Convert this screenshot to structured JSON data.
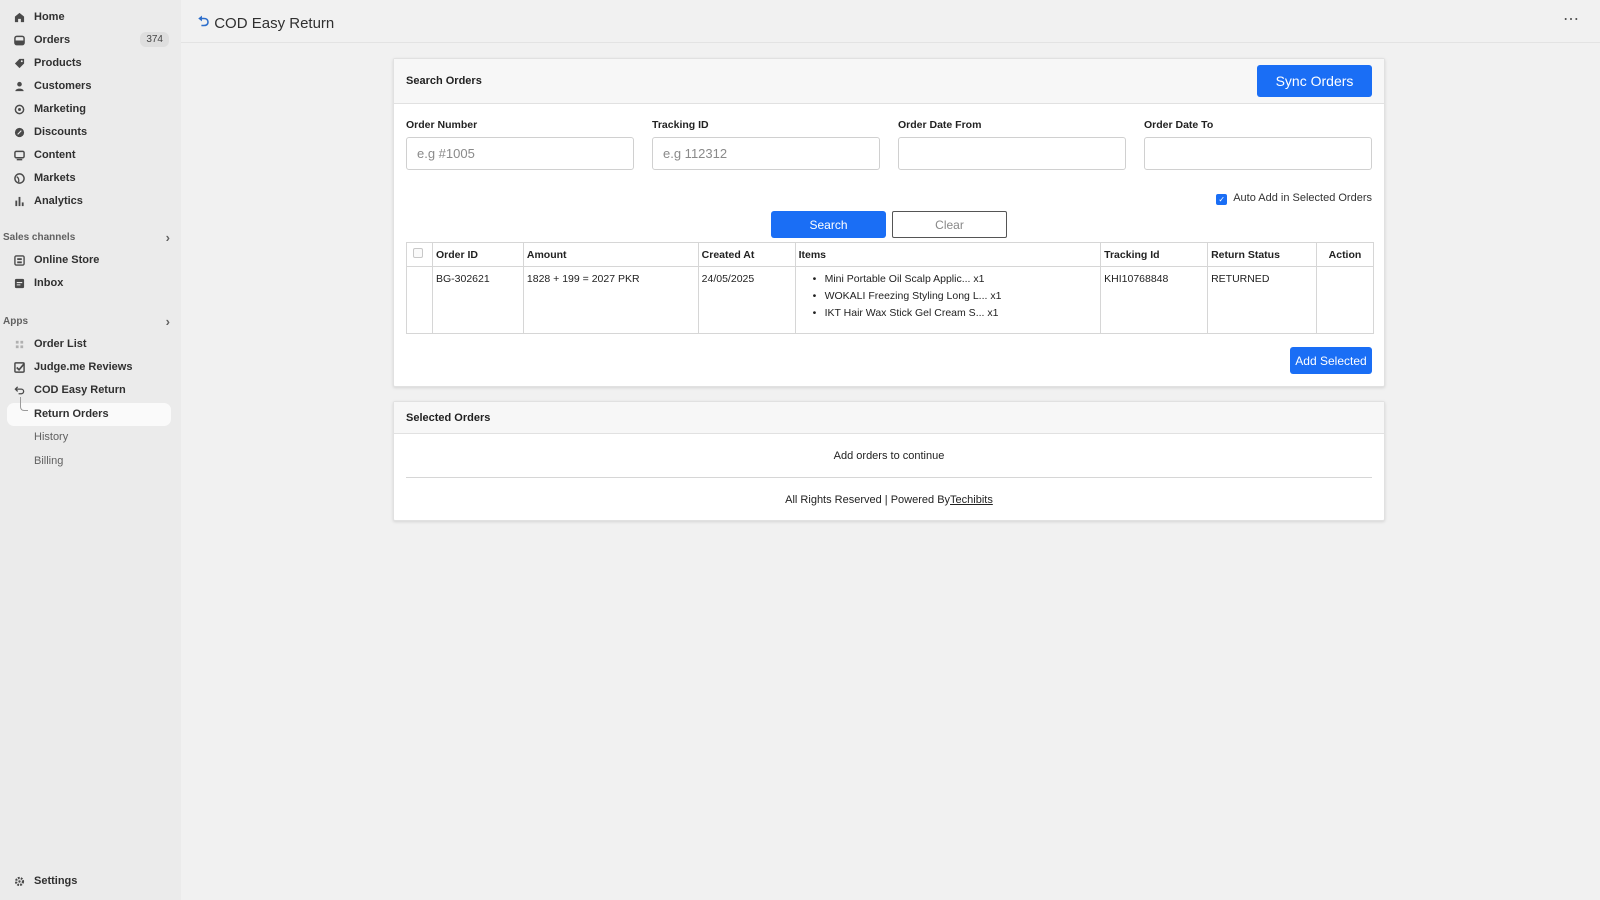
{
  "sidebar": {
    "nav": [
      {
        "label": "Home",
        "icon": "home-icon"
      },
      {
        "label": "Orders",
        "icon": "orders-icon",
        "badge": "374"
      },
      {
        "label": "Products",
        "icon": "tag-icon"
      },
      {
        "label": "Customers",
        "icon": "person-icon"
      },
      {
        "label": "Marketing",
        "icon": "target-icon"
      },
      {
        "label": "Discounts",
        "icon": "discount-icon"
      },
      {
        "label": "Content",
        "icon": "content-icon"
      },
      {
        "label": "Markets",
        "icon": "globe-icon"
      },
      {
        "label": "Analytics",
        "icon": "bar-chart-icon"
      }
    ],
    "sales_channels": {
      "heading": "Sales channels",
      "items": [
        {
          "label": "Online Store",
          "icon": "store-icon"
        },
        {
          "label": "Inbox",
          "icon": "inbox-icon"
        }
      ]
    },
    "apps": {
      "heading": "Apps",
      "items": [
        {
          "label": "Order List",
          "icon": "grid-icon"
        },
        {
          "label": "Judge.me Reviews",
          "icon": "review-check-icon"
        },
        {
          "label": "COD Easy Return",
          "icon": "return-arrow-icon"
        }
      ],
      "sub_items": [
        "Return Orders",
        "History",
        "Billing"
      ]
    },
    "settings_label": "Settings"
  },
  "header": {
    "title": "COD Easy Return"
  },
  "search_card": {
    "title": "Search Orders",
    "sync_label": "Sync Orders",
    "fields": {
      "order_number": {
        "label": "Order Number",
        "placeholder": "e.g #1005"
      },
      "tracking_id": {
        "label": "Tracking ID",
        "placeholder": "e.g 112312"
      },
      "date_from": {
        "label": "Order Date From",
        "placeholder": ""
      },
      "date_to": {
        "label": "Order Date To",
        "placeholder": ""
      }
    },
    "auto_add_label": "Auto Add in Selected Orders",
    "search_label": "Search",
    "clear_label": "Clear",
    "add_selected_label": "Add Selected",
    "table": {
      "headers": [
        "Order ID",
        "Amount",
        "Created At",
        "Items",
        "Tracking Id",
        "Return Status",
        "Action"
      ],
      "rows": [
        {
          "order_id": "BG-302621",
          "amount": "1828 + 199 = 2027 PKR",
          "created_at": "24/05/2025",
          "items": [
            "Mini Portable Oil Scalp Applic... x1",
            "WOKALI Freezing Styling Long L... x1",
            "IKT Hair Wax Stick Gel Cream S... x1"
          ],
          "tracking_id": "KHI10768848",
          "return_status": "RETURNED",
          "action": ""
        }
      ]
    }
  },
  "selected_card": {
    "title": "Selected Orders",
    "empty_text": "Add orders to continue",
    "footer_text": "All Rights Reserved | Powered By",
    "footer_link": "Techibits"
  },
  "colors": {
    "primary": "#1a6ef5",
    "sidebar_bg": "#ebebeb",
    "page_bg": "#f1f1f1"
  }
}
